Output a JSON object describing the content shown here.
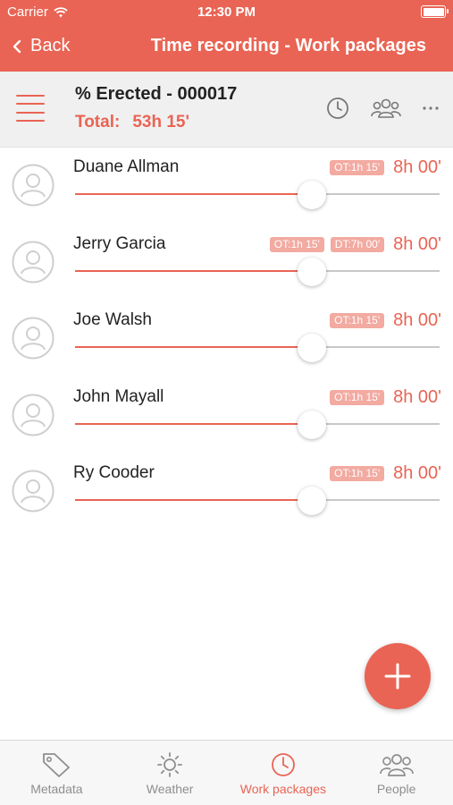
{
  "status_bar": {
    "carrier": "Carrier",
    "time": "12:30 PM"
  },
  "nav": {
    "back_label": "Back",
    "title": "Time recording - Work packages"
  },
  "work_package": {
    "title": "% Erected - 000017",
    "total_label": "Total:",
    "total_value": "53h 15'"
  },
  "workers": [
    {
      "name": "Duane Allman",
      "badges": [
        "OT:1h 15'"
      ],
      "hours": "8h 00'",
      "slider_fraction": 0.65
    },
    {
      "name": "Jerry Garcia",
      "badges": [
        "OT:1h 15'",
        "DT:7h 00'"
      ],
      "hours": "8h 00'",
      "slider_fraction": 0.65
    },
    {
      "name": "Joe Walsh",
      "badges": [
        "OT:1h 15'"
      ],
      "hours": "8h 00'",
      "slider_fraction": 0.65
    },
    {
      "name": "John Mayall",
      "badges": [
        "OT:1h 15'"
      ],
      "hours": "8h 00'",
      "slider_fraction": 0.65
    },
    {
      "name": "Ry Cooder",
      "badges": [
        "OT:1h 15'"
      ],
      "hours": "8h 00'",
      "slider_fraction": 0.65
    }
  ],
  "tabs": [
    {
      "label": "Metadata",
      "icon": "tag-icon",
      "active": false
    },
    {
      "label": "Weather",
      "icon": "sun-icon",
      "active": false
    },
    {
      "label": "Work packages",
      "icon": "clock-icon",
      "active": true
    },
    {
      "label": "People",
      "icon": "people-icon",
      "active": false
    }
  ],
  "colors": {
    "accent": "#e96454",
    "badge": "#f2aaa1",
    "subheader_bg": "#f0f0f0",
    "tab_inactive": "#8e8e8e"
  }
}
